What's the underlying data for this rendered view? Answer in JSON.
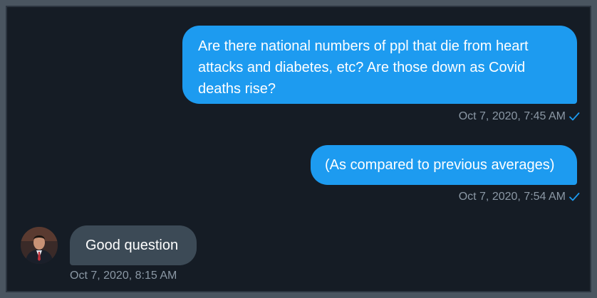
{
  "messages": [
    {
      "direction": "outgoing",
      "text": "Are there national numbers of ppl that die from heart attacks and diabetes, etc? Are those down as Covid deaths rise?",
      "timestamp": "Oct 7, 2020, 7:45 AM",
      "status_icon": "checkmark-icon"
    },
    {
      "direction": "outgoing",
      "text": "(As compared to previous averages)",
      "timestamp": "Oct 7, 2020, 7:54 AM",
      "status_icon": "checkmark-icon"
    },
    {
      "direction": "incoming",
      "text": "Good question",
      "timestamp": "Oct 7, 2020, 8:15 AM",
      "avatar": "avatar"
    }
  ],
  "colors": {
    "outgoing_bubble": "#1d9bf0",
    "incoming_bubble": "#3c4a56",
    "background": "#151c25",
    "timestamp": "#8b98a5",
    "checkmark": "#1d9bf0"
  }
}
